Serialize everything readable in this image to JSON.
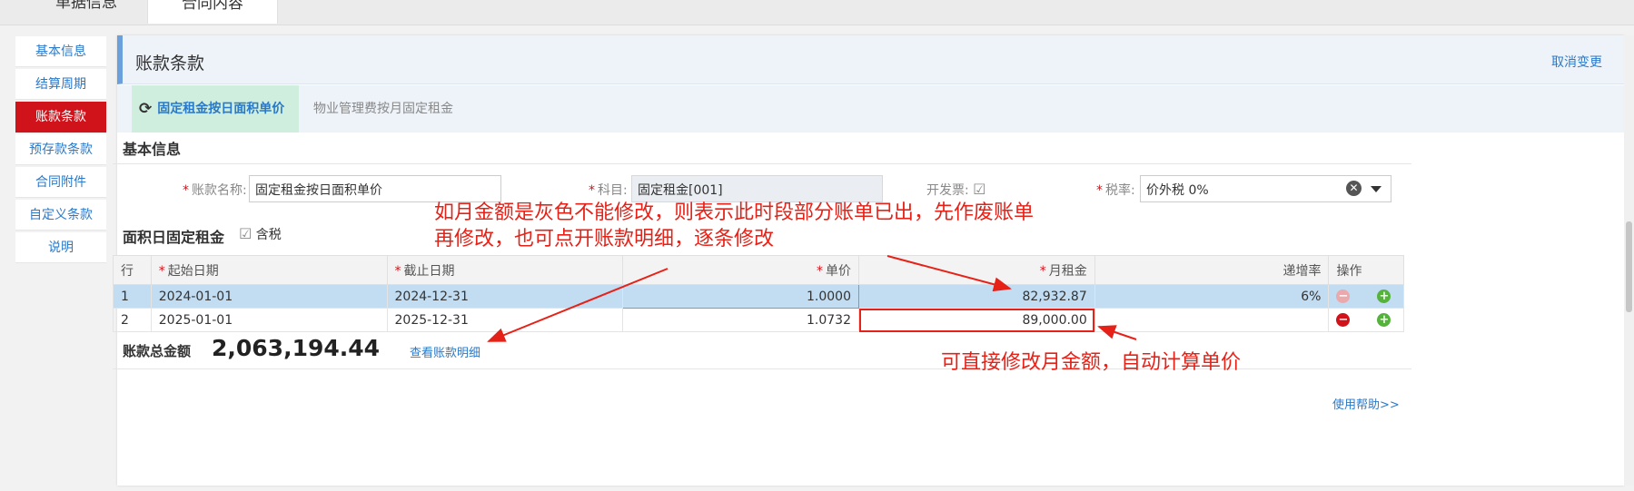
{
  "top_tabs": [
    "单据信息",
    "合同内容"
  ],
  "nav": [
    "基本信息",
    "结算周期",
    "账款条款",
    "预存款条款",
    "合同附件",
    "自定义条款",
    "说明"
  ],
  "panel": {
    "title": "账款条款",
    "cancel_change": "取消变更",
    "subtabs": [
      "固定租金按日面积单价",
      "物业管理费按月固定租金"
    ]
  },
  "basic_info": {
    "title": "基本信息",
    "account_name_label": "账款名称:",
    "account_name_value": "固定租金按日面积单价",
    "subject_label": "科目:",
    "subject_value": "固定租金[001]",
    "invoice_label": "开发票:",
    "tax_rate_label": "税率:",
    "tax_rate_value": "价外税 0%"
  },
  "rent": {
    "title": "面积日固定租金",
    "tax_included_label": "含税",
    "columns": [
      "行",
      "起始日期",
      "截止日期",
      "单价",
      "月租金",
      "递增率",
      "操作"
    ],
    "rows": [
      {
        "row": "1",
        "start": "2024-01-01",
        "end": "2024-12-31",
        "unit_price": "1.0000",
        "monthly_rent": "82,932.87",
        "increase_rate": "6%"
      },
      {
        "row": "2",
        "start": "2025-01-01",
        "end": "2025-12-31",
        "unit_price": "1.0732",
        "monthly_rent": "89,000.00",
        "increase_rate": ""
      }
    ]
  },
  "total": {
    "label": "账款总金额",
    "value": "2,063,194.44"
  },
  "detail_link": "查看账款明细",
  "help_link": "使用帮助>>",
  "annotations": {
    "note1_line1": "如月金额是灰色不能修改，则表示此时段部分账单已出，先作废账单",
    "note1_line2": "再修改，也可点开账款明细，逐条修改",
    "note2": "可直接修改月金额，自动计算单价"
  },
  "colors": {
    "accent": "#2a79c9",
    "active_nav": "#d0121b",
    "annotation": "#e62117",
    "selected_row": "#c2dcf2"
  }
}
